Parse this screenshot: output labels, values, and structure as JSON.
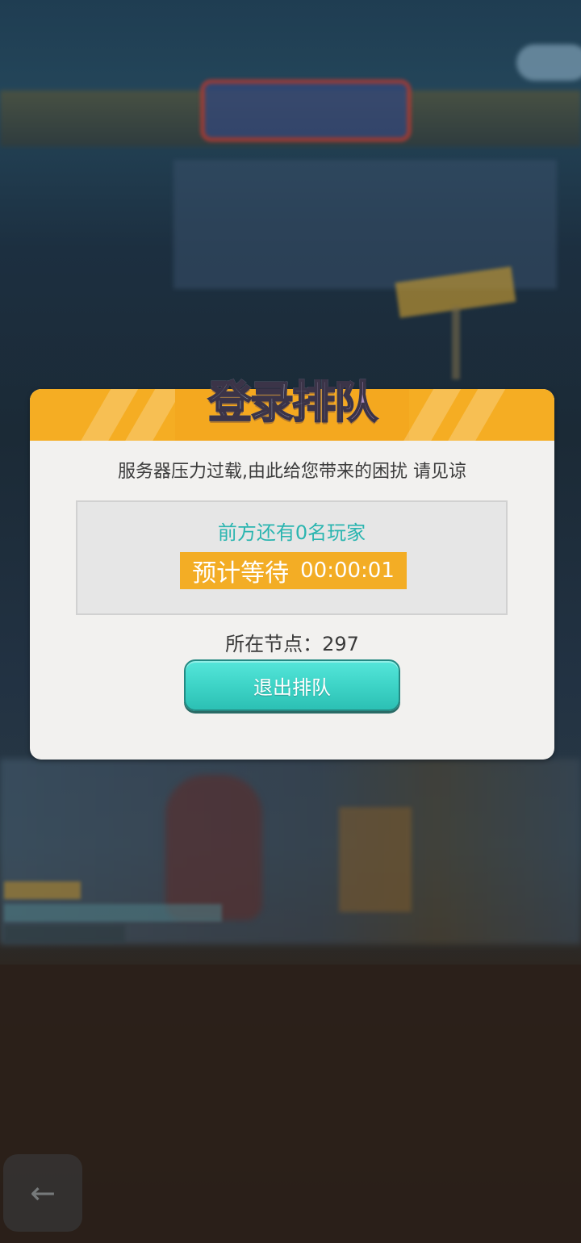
{
  "dialog": {
    "title": "登录排队",
    "message": "服务器压力过载,由此给您带来的困扰 请见谅",
    "queue_ahead": "前方还有0名玩家",
    "wait_label": "预计等待",
    "wait_time": "00:00:01",
    "node_label": "所在节点：",
    "node_value": "297",
    "exit_button": "退出排队"
  },
  "colors": {
    "header": "#f5ad23",
    "accent_teal": "#2bb5b0",
    "button": "#3ed4c7",
    "pill": "#f3ad25"
  },
  "icons": {
    "back": "back-arrow-icon"
  }
}
